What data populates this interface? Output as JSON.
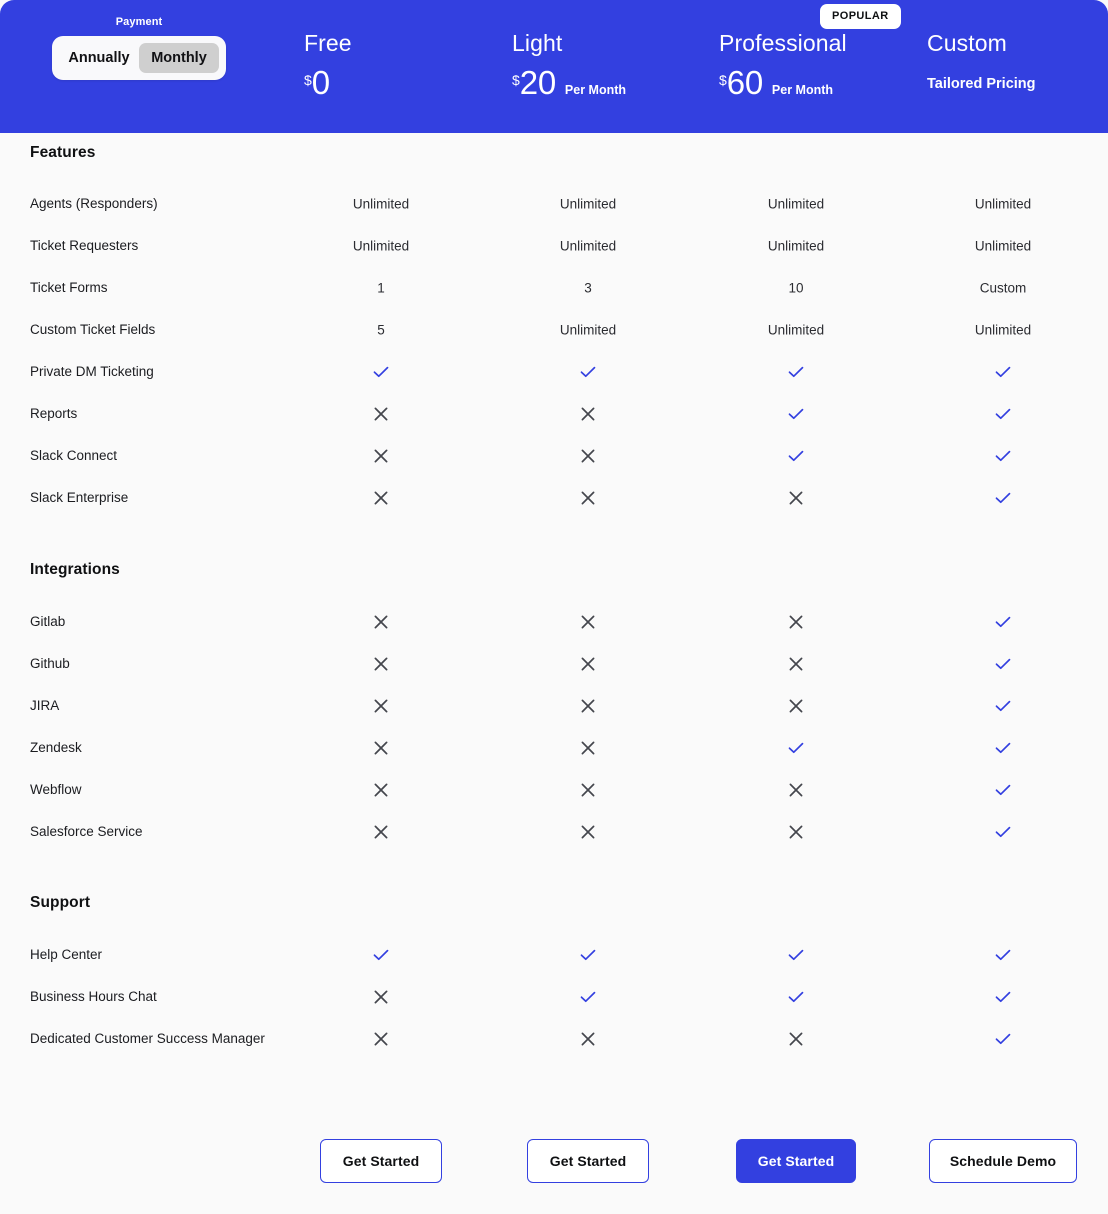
{
  "theme": {
    "accent": "#3340e0",
    "check_color": "#3340e0",
    "cross_color": "#44464d",
    "page_bg": "#fafafa",
    "header_text": "#ffffff"
  },
  "header": {
    "payment_label": "Payment",
    "toggle": {
      "options": [
        "Annually",
        "Monthly"
      ],
      "selected": "Monthly"
    },
    "popular_badge": "POPULAR",
    "plans": [
      {
        "name": "Free",
        "currency": "$",
        "amount": "0",
        "period": "",
        "note": "",
        "popular": false
      },
      {
        "name": "Light",
        "currency": "$",
        "amount": "20",
        "period": "Per Month",
        "note": "",
        "popular": false
      },
      {
        "name": "Professional",
        "currency": "$",
        "amount": "60",
        "period": "Per Month",
        "note": "",
        "popular": true
      },
      {
        "name": "Custom",
        "currency": "",
        "amount": "",
        "period": "",
        "note": "Tailored Pricing",
        "popular": false
      }
    ]
  },
  "sections": [
    {
      "title": "Features",
      "rows": [
        {
          "label": "Agents (Responders)",
          "values": [
            "Unlimited",
            "Unlimited",
            "Unlimited",
            "Unlimited"
          ]
        },
        {
          "label": "Ticket Requesters",
          "values": [
            "Unlimited",
            "Unlimited",
            "Unlimited",
            "Unlimited"
          ]
        },
        {
          "label": "Ticket Forms",
          "values": [
            "1",
            "3",
            "10",
            "Custom"
          ]
        },
        {
          "label": "Custom Ticket Fields",
          "values": [
            "5",
            "Unlimited",
            "Unlimited",
            "Unlimited"
          ]
        },
        {
          "label": "Private DM Ticketing",
          "values": [
            "check",
            "check",
            "check",
            "check"
          ]
        },
        {
          "label": "Reports",
          "values": [
            "cross",
            "cross",
            "check",
            "check"
          ]
        },
        {
          "label": "Slack Connect",
          "values": [
            "cross",
            "cross",
            "check",
            "check"
          ]
        },
        {
          "label": "Slack Enterprise",
          "values": [
            "cross",
            "cross",
            "cross",
            "check"
          ]
        }
      ]
    },
    {
      "title": "Integrations",
      "rows": [
        {
          "label": "Gitlab",
          "values": [
            "cross",
            "cross",
            "cross",
            "check"
          ]
        },
        {
          "label": "Github",
          "values": [
            "cross",
            "cross",
            "cross",
            "check"
          ]
        },
        {
          "label": "JIRA",
          "values": [
            "cross",
            "cross",
            "cross",
            "check"
          ]
        },
        {
          "label": "Zendesk",
          "values": [
            "cross",
            "cross",
            "check",
            "check"
          ]
        },
        {
          "label": "Webflow",
          "values": [
            "cross",
            "cross",
            "cross",
            "check"
          ]
        },
        {
          "label": "Salesforce Service",
          "values": [
            "cross",
            "cross",
            "cross",
            "check"
          ]
        }
      ]
    },
    {
      "title": "Support",
      "rows": [
        {
          "label": "Help Center",
          "values": [
            "check",
            "check",
            "check",
            "check"
          ]
        },
        {
          "label": "Business Hours Chat",
          "values": [
            "cross",
            "check",
            "check",
            "check"
          ]
        },
        {
          "label": "Dedicated Customer Success Manager",
          "values": [
            "cross",
            "cross",
            "cross",
            "check"
          ]
        }
      ]
    }
  ],
  "footer": {
    "buttons": [
      {
        "label": "Get Started",
        "style": "outline"
      },
      {
        "label": "Get Started",
        "style": "outline"
      },
      {
        "label": "Get Started",
        "style": "filled"
      },
      {
        "label": "Schedule Demo",
        "style": "outline"
      }
    ]
  }
}
